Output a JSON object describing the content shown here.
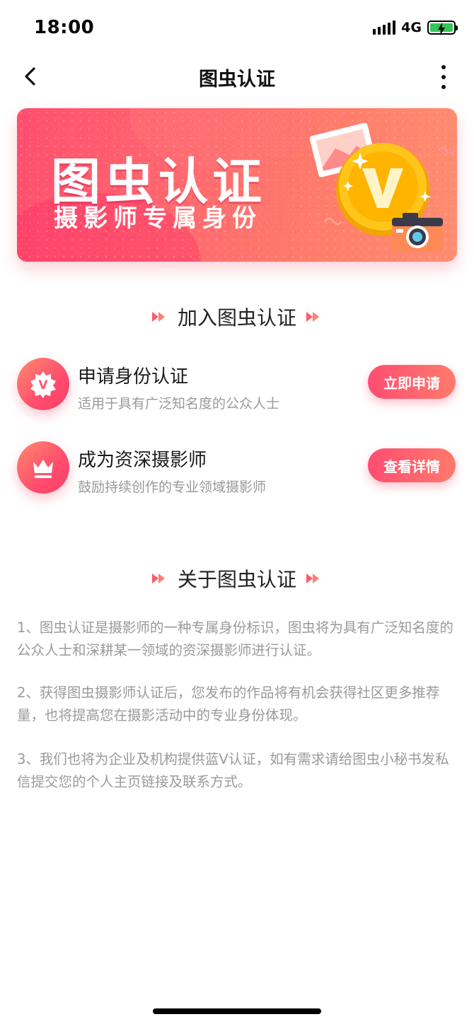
{
  "status_bar": {
    "time": "18:00",
    "network": "4G",
    "signal_icon": "signal-bars-icon",
    "battery_icon": "battery-charging-icon",
    "battery_color": "#35c659"
  },
  "nav": {
    "title": "图虫认证",
    "back_icon": "chevron-left-icon",
    "more_icon": "more-vertical-icon"
  },
  "banner": {
    "title": "图虫认证",
    "subtitle": "摄影师专属身份",
    "art_icon": "gold-v-badge-camera-illustration"
  },
  "join_section": {
    "heading": "加入图虫认证",
    "items": [
      {
        "icon": "v-badge-icon",
        "title": "申请身份认证",
        "desc": "适用于具有广泛知名度的公众人士",
        "button": "立即申请"
      },
      {
        "icon": "crown-icon",
        "title": "成为资深摄影师",
        "desc": "鼓励持续创作的专业领域摄影师",
        "button": "查看详情"
      }
    ]
  },
  "about_section": {
    "heading": "关于图虫认证",
    "paragraphs": [
      "1、图虫认证是摄影师的一种专属身份标识，图虫将为具有广泛知名度的公众人士和深耕某一领域的资深摄影师进行认证。",
      "2、获得图虫摄影师认证后，您发布的作品将有机会获得社区更多推荐量，也将提高您在摄影活动中的专业身份体现。",
      "3、我们也将为企业及机构提供蓝V认证，如有需求请给图虫小秘书发私信提交您的个人主页链接及联系方式。"
    ]
  },
  "colors": {
    "accent": "#ff4d6d",
    "accent_light": "#ff7a6b",
    "text_secondary": "#999999"
  }
}
